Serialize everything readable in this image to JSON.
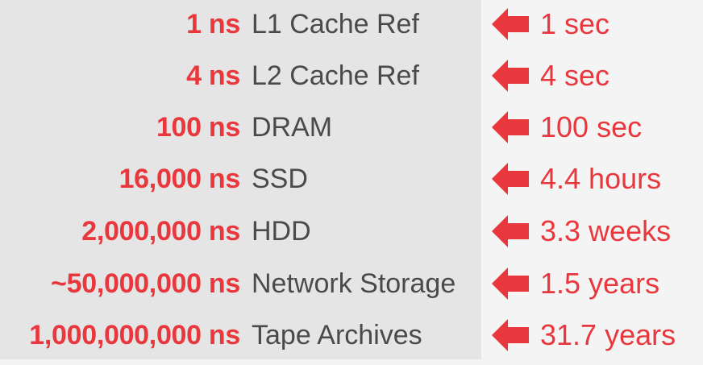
{
  "colors": {
    "accent": "#e8383d",
    "text": "#4a4a4a",
    "left_bg": "#e5e5e5",
    "right_bg": "#f4f4f4"
  },
  "rows": [
    {
      "latency": "1 ns",
      "label": "L1 Cache Ref",
      "human": "1 sec"
    },
    {
      "latency": "4 ns",
      "label": "L2 Cache Ref",
      "human": "4 sec"
    },
    {
      "latency": "100 ns",
      "label": "DRAM",
      "human": "100 sec"
    },
    {
      "latency": "16,000 ns",
      "label": "SSD",
      "human": "4.4 hours"
    },
    {
      "latency": "2,000,000 ns",
      "label": "HDD",
      "human": "3.3 weeks"
    },
    {
      "latency": "~50,000,000 ns",
      "label": "Network Storage",
      "human": "1.5 years"
    },
    {
      "latency": "1,000,000,000 ns",
      "label": "Tape Archives",
      "human": "31.7 years"
    }
  ],
  "icons": {
    "arrow": "left-arrow-icon"
  }
}
